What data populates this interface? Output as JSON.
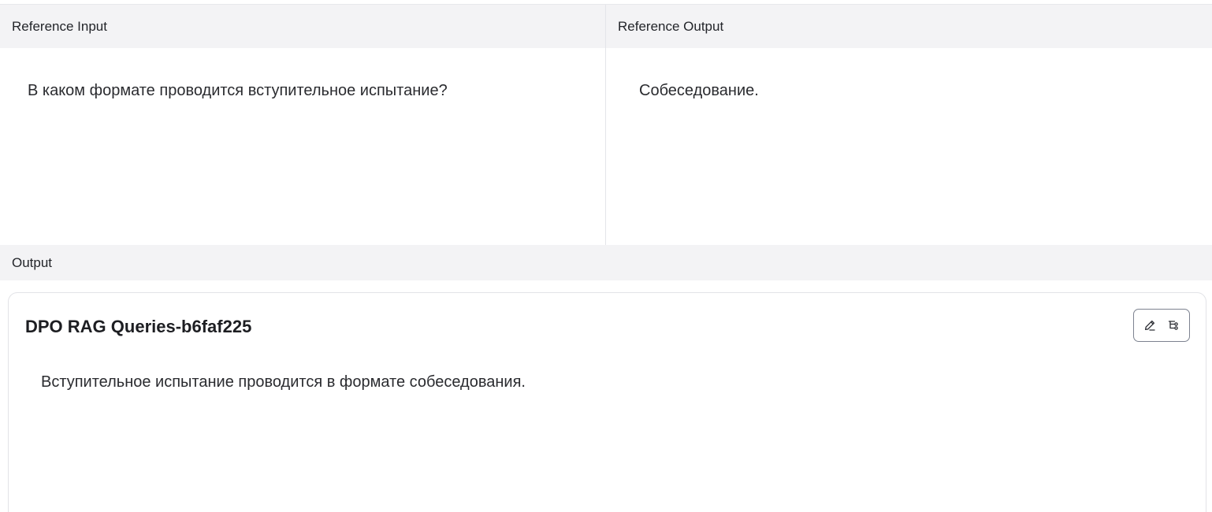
{
  "reference": {
    "input": {
      "header": "Reference Input",
      "text": "В каком формате проводится вступительное испытание?"
    },
    "output": {
      "header": "Reference Output",
      "text": "Собеседование."
    }
  },
  "output_section": {
    "header": "Output",
    "card": {
      "title": "DPO RAG Queries-b6faf225",
      "text": "Вступительное испытание проводится в формате собеседования.",
      "actions": [
        "pencil-icon",
        "branch-icon"
      ]
    }
  }
}
